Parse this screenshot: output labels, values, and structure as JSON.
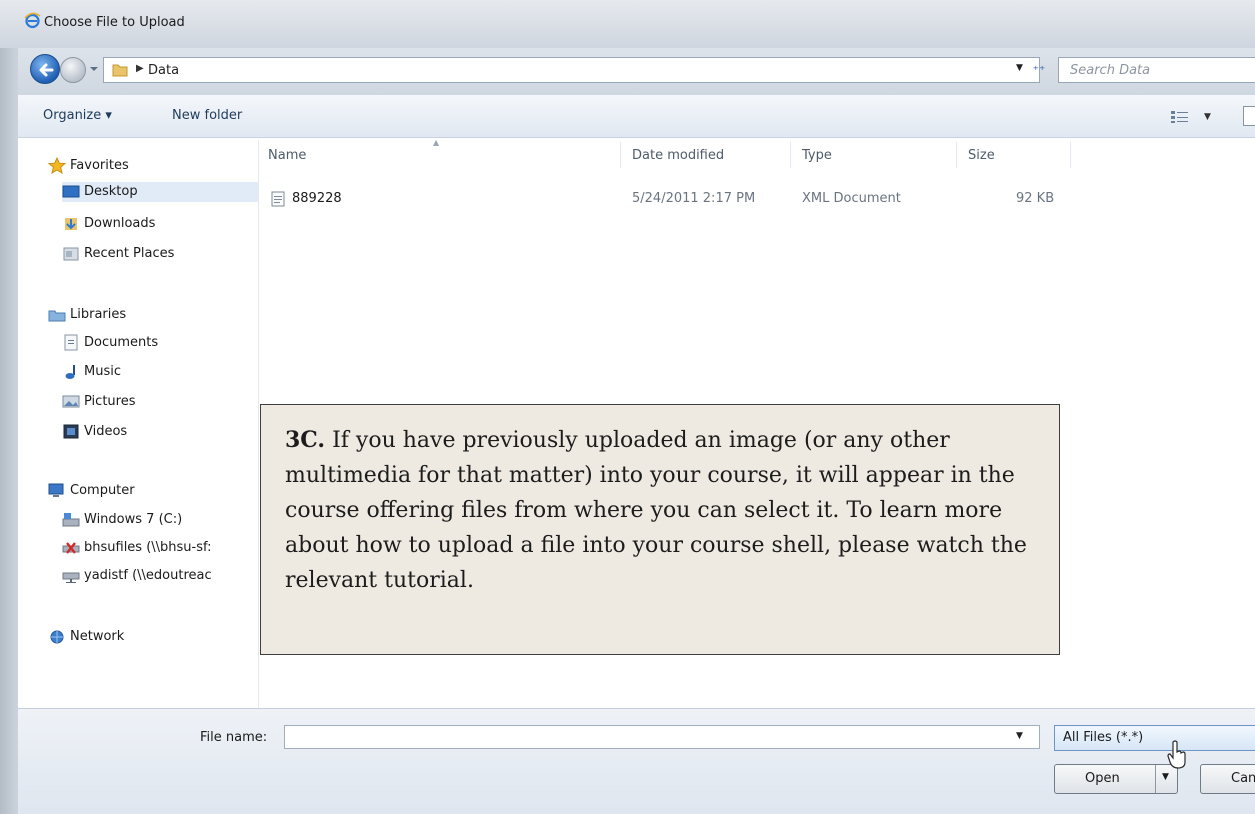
{
  "window": {
    "title": "Choose File to Upload"
  },
  "address": {
    "path": "Data",
    "search_placeholder": "Search Data"
  },
  "toolbar": {
    "organize_label": "Organize ▾",
    "new_folder_label": "New folder"
  },
  "nav": {
    "favorites": {
      "label": "Favorites",
      "items": [
        "Desktop",
        "Downloads",
        "Recent Places"
      ]
    },
    "libraries": {
      "label": "Libraries",
      "items": [
        "Documents",
        "Music",
        "Pictures",
        "Videos"
      ]
    },
    "computer": {
      "label": "Computer",
      "items": [
        "Windows 7 (C:)",
        "bhsufiles (\\\\bhsu-sf:",
        "yadistf (\\\\edoutreac"
      ]
    },
    "network": {
      "label": "Network"
    }
  },
  "columns": {
    "name": "Name",
    "date": "Date modified",
    "type": "Type",
    "size": "Size"
  },
  "files": [
    {
      "name": "889228",
      "date": "5/24/2011 2:17 PM",
      "type": "XML Document",
      "size": "92 KB"
    }
  ],
  "callout": {
    "label": "3C.",
    "text": " If you have previously uploaded an image (or any other multimedia for that matter) into your course, it will appear in the course offering files from where you can select it. To learn more about how to upload a file into your course shell, please watch the relevant tutorial."
  },
  "bottom": {
    "file_name_label": "File name:",
    "file_name_value": "",
    "filter": "All Files (*.*)",
    "open_label": "Open",
    "cancel_label": "Cancel"
  },
  "colors": {
    "selection": "#e1ebf7",
    "callout_bg": "#eeeae2",
    "link_blue": "#1e3b5a"
  }
}
